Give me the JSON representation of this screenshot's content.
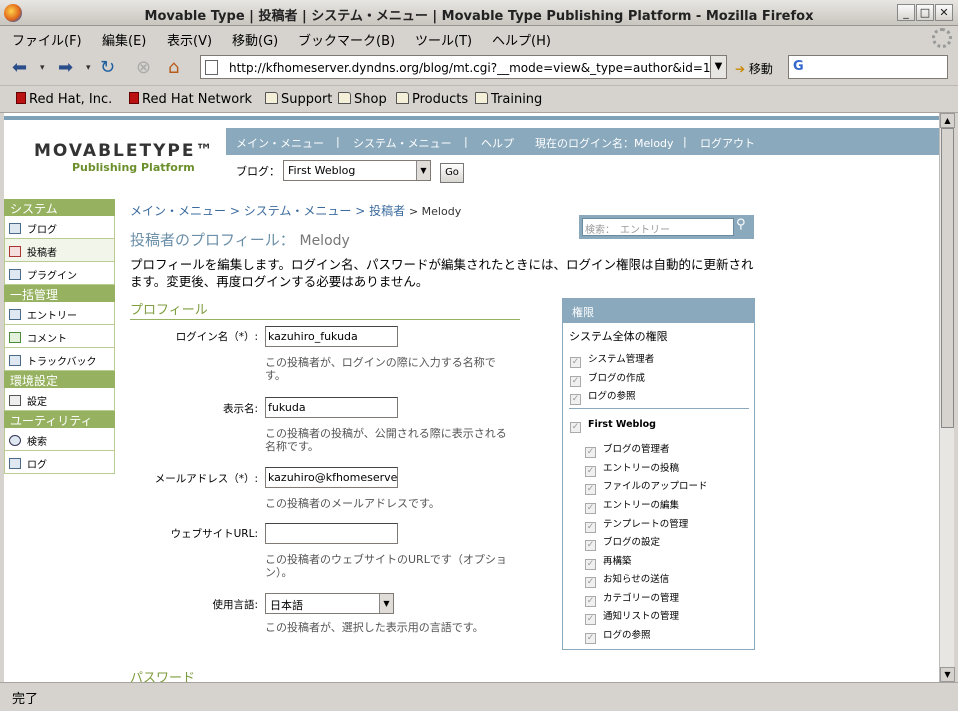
{
  "window": {
    "title": "Movable Type | 投稿者 | システム・メニュー | Movable Type Publishing Platform - Mozilla Firefox"
  },
  "menu": {
    "items": [
      "ファイル(F)",
      "編集(E)",
      "表示(V)",
      "移動(G)",
      "ブックマーク(B)",
      "ツール(T)",
      "ヘルプ(H)"
    ]
  },
  "toolbar": {
    "url": "http://kfhomeserver.dyndns.org/blog/mt.cgi?__mode=view&_type=author&id=1",
    "go_label": "移動"
  },
  "bookmarks": {
    "items": [
      "Red Hat, Inc.",
      "Red Hat Network",
      "Support",
      "Shop",
      "Products",
      "Training"
    ]
  },
  "mt": {
    "logo_main": "MOVABLETYPE™",
    "logo_sub": "Publishing Platform",
    "nav": [
      "メイン・メニュー",
      "|",
      "システム・メニュー",
      "|",
      "ヘルプ",
      "現在のログイン名：Melody",
      "|",
      "ログアウト"
    ],
    "blog_label": "ブログ：",
    "blog_value": "First Weblog",
    "go_button": "Go"
  },
  "sidebar": {
    "sections": [
      {
        "title": "システム",
        "items": [
          "ブログ",
          "投稿者",
          "プラグイン"
        ]
      },
      {
        "title": "一括管理",
        "items": [
          "エントリー",
          "コメント",
          "トラックバック"
        ]
      },
      {
        "title": "環境設定",
        "items": [
          "設定"
        ]
      },
      {
        "title": "ユーティリティ",
        "items": [
          "検索",
          "ログ"
        ]
      }
    ]
  },
  "main": {
    "breadcrumb": [
      "メイン・メニュー",
      ">",
      "システム・メニュー",
      ">",
      "投稿者",
      "> Melody"
    ],
    "search_placeholder": "検索：　エントリー",
    "title": "投稿者のプロフィール：",
    "title_name": "Melody",
    "description": "プロフィールを編集します。ログイン名、パスワードが編集されたときには、ログイン権限は自動的に更新されます。変更後、再度ログインする必要はありません。",
    "profile_section": "プロフィール",
    "password_section": "パスワード",
    "fields": {
      "login_label": "ログイン名（*）:",
      "login_value": "kazuhiro_fukuda",
      "login_hint": "この投稿者が、ログインの際に入力する名称です。",
      "display_label": "表示名:",
      "display_value": "fukuda",
      "display_hint": "この投稿者の投稿が、公開される際に表示される名称です。",
      "email_label": "メールアドレス（*）:",
      "email_value": "kazuhiro@kfhomeserver.d",
      "email_hint": "この投稿者のメールアドレスです。",
      "url_label": "ウェブサイトURL:",
      "url_value": "",
      "url_hint": "この投稿者のウェブサイトのURLです（オプション）。",
      "lang_label": "使用言語:",
      "lang_value": "日本語",
      "lang_hint": "この投稿者が、選択した表示用の言語です。"
    }
  },
  "permissions": {
    "header": "権限",
    "system_title": "システム全体の権限",
    "system_items": [
      "システム管理者",
      "ブログの作成",
      "ログの参照"
    ],
    "blog_name": "First Weblog",
    "blog_items": [
      "ブログの管理者",
      "エントリーの投稿",
      "ファイルのアップロード",
      "エントリーの編集",
      "テンプレートの管理",
      "ブログの設定",
      "再構築",
      "お知らせの送信",
      "カテゴリーの管理",
      "通知リストの管理",
      "ログの参照"
    ]
  },
  "status": {
    "text": "完了"
  }
}
